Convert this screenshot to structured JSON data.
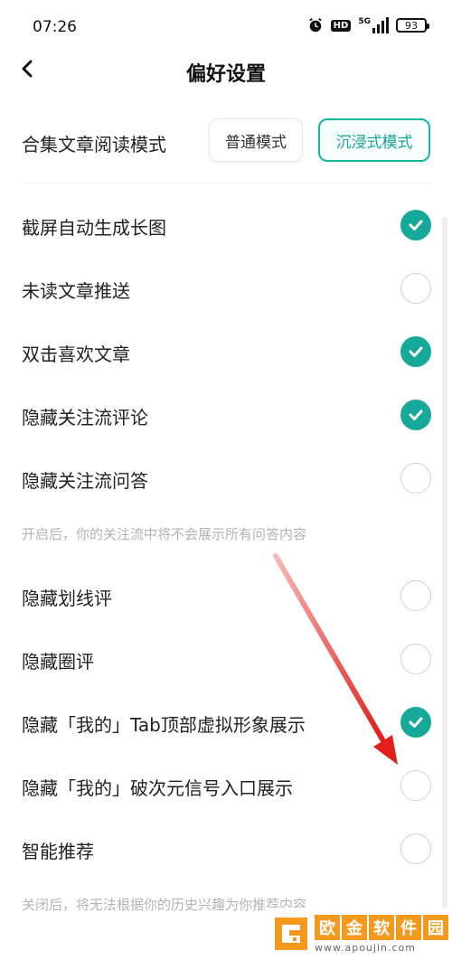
{
  "status_bar": {
    "time": "07:26",
    "hd": "HD",
    "network": "5G",
    "battery": "93"
  },
  "nav": {
    "title": "偏好设置"
  },
  "reading_mode": {
    "label": "合集文章阅读模式",
    "options": [
      "普通模式",
      "沉浸式模式"
    ],
    "selected": "沉浸式模式"
  },
  "settings": [
    {
      "label": "截屏自动生成长图",
      "checked": true
    },
    {
      "label": "未读文章推送",
      "checked": false
    },
    {
      "label": "双击喜欢文章",
      "checked": true
    },
    {
      "label": "隐藏关注流评论",
      "checked": true
    },
    {
      "label": "隐藏关注流问答",
      "checked": false
    },
    {
      "label": "隐藏划线评",
      "checked": false
    },
    {
      "label": "隐藏圈评",
      "checked": false
    },
    {
      "label": "隐藏「我的」Tab顶部虚拟形象展示",
      "checked": true
    },
    {
      "label": "隐藏「我的」破次元信号入口展示",
      "checked": false
    },
    {
      "label": "智能推荐",
      "checked": false
    }
  ],
  "hints": {
    "qa_hint": "开启后，你的关注流中将不会展示所有问答内容",
    "recommend_hint": "关闭后，将无法根据你的历史兴趣为你推荐内容"
  },
  "watermark": {
    "title_chars": [
      "欧",
      "金",
      "软",
      "件",
      "园"
    ],
    "url": "www.apoujin.com"
  },
  "colors": {
    "accent": "#16a898",
    "arrow": "#e0201c",
    "watermark": "#f39a1e"
  }
}
